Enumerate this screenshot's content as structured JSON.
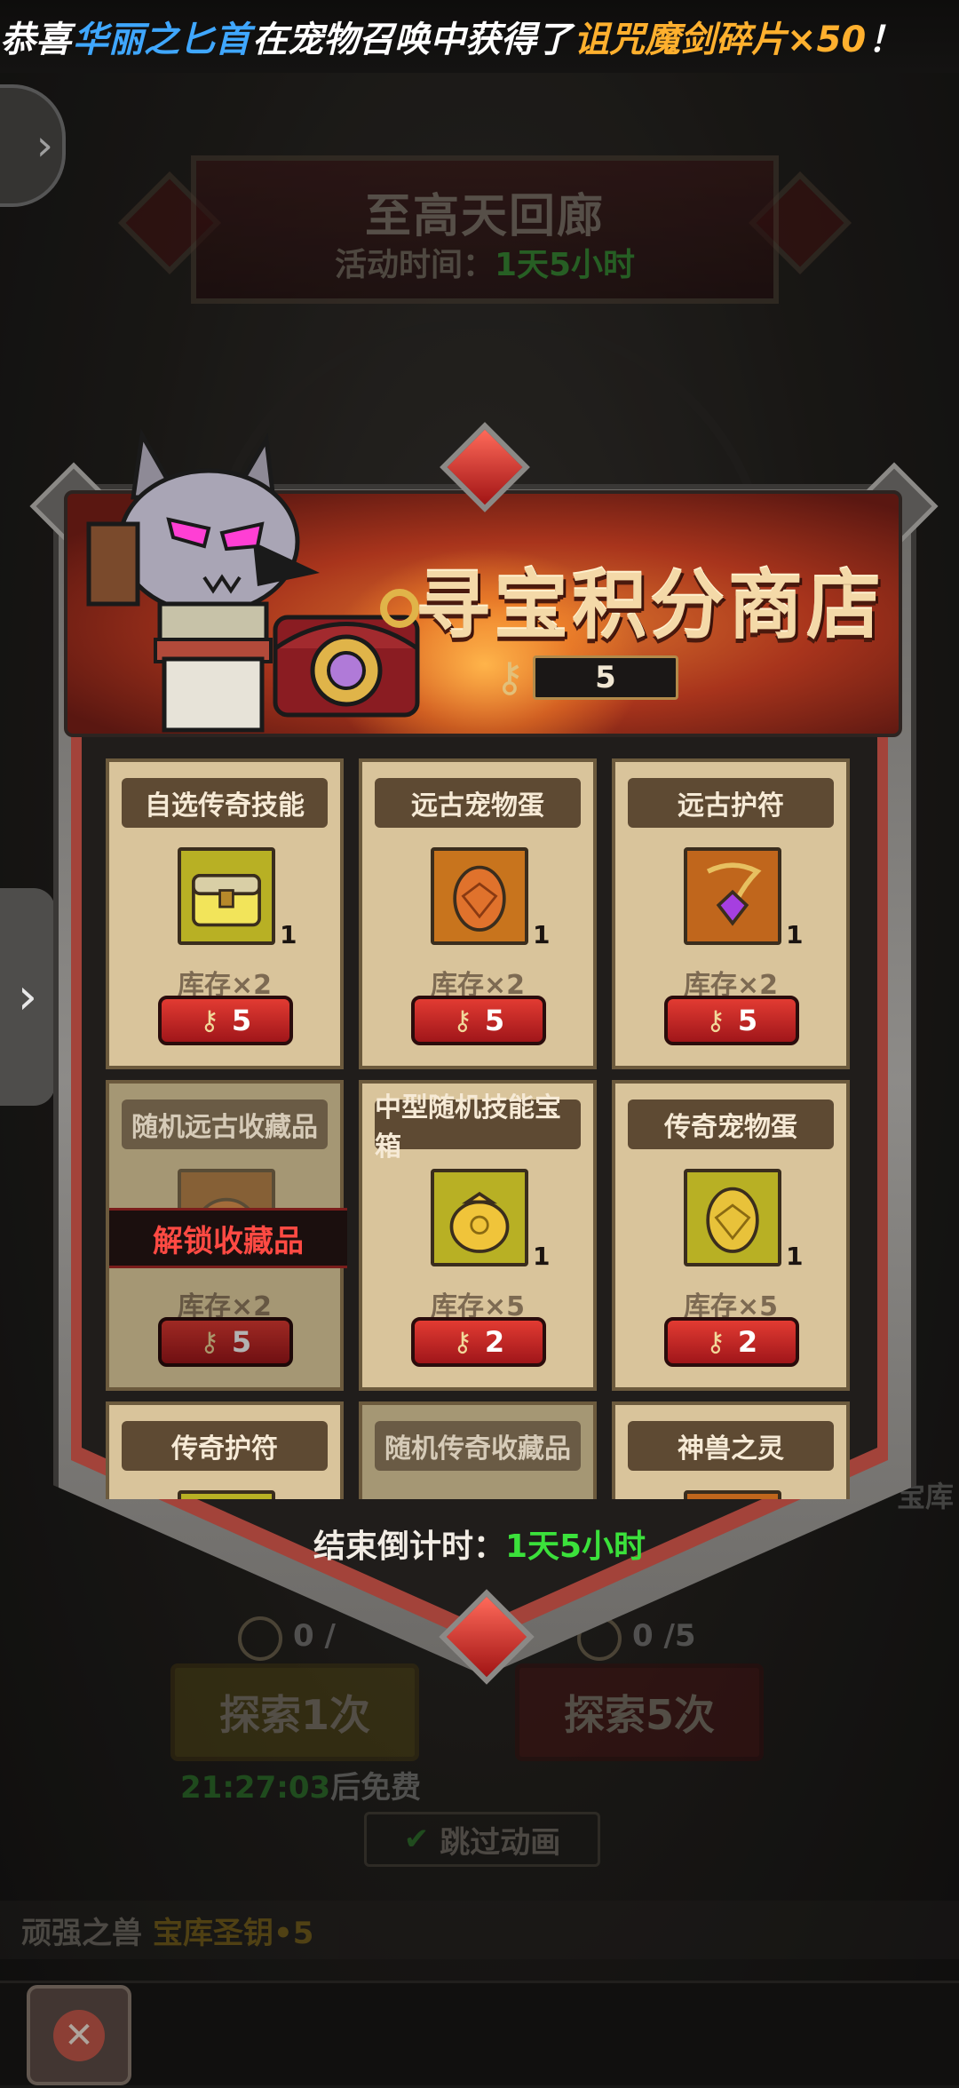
{
  "ticker": {
    "prefix": "恭喜",
    "player": "华丽之匕首",
    "middle": "在宠物召唤中获得了",
    "item": "诅咒魔剑碎片×50",
    "suffix": "！"
  },
  "event": {
    "title": "至高天回廊",
    "time_label": "活动时间：",
    "time_value": "1天5小时"
  },
  "shop": {
    "title": "寻宝积分商店",
    "key_count": "5",
    "items": [
      {
        "name": "自选传奇技能",
        "qty": "1",
        "stock": "库存×2",
        "price": "5",
        "locked": false,
        "icon": "chest-icon"
      },
      {
        "name": "远古宠物蛋",
        "qty": "1",
        "stock": "库存×2",
        "price": "5",
        "locked": false,
        "icon": "egg-icon"
      },
      {
        "name": "远古护符",
        "qty": "1",
        "stock": "库存×2",
        "price": "5",
        "locked": false,
        "icon": "amulet-icon"
      },
      {
        "name": "随机远古收藏品",
        "qty": "",
        "stock": "库存×2",
        "price": "5",
        "locked": true,
        "lock_text": "解锁收藏品",
        "icon": "bag-icon"
      },
      {
        "name": "中型随机技能宝箱",
        "qty": "1",
        "stock": "库存×5",
        "price": "2",
        "locked": false,
        "icon": "bag-icon"
      },
      {
        "name": "传奇宠物蛋",
        "qty": "1",
        "stock": "库存×5",
        "price": "2",
        "locked": false,
        "icon": "egg-icon"
      },
      {
        "name": "传奇护符",
        "qty": "",
        "stock": "",
        "price": "",
        "locked": false,
        "icon": "amulet-icon"
      },
      {
        "name": "随机传奇收藏品",
        "qty": "",
        "stock": "",
        "price": "",
        "locked": true,
        "icon": "bag-icon"
      },
      {
        "name": "神兽之灵",
        "qty": "",
        "stock": "",
        "price": "",
        "locked": false,
        "icon": "spirit-icon"
      }
    ],
    "countdown_label": "结束倒计时：",
    "countdown_value": "1天5小时"
  },
  "background": {
    "count_left": "0 /",
    "count_right": "0 /5",
    "explore1": "探索1次",
    "explore5": "探索5次",
    "free_time": "21:27:03",
    "free_suffix": "后免费",
    "skip": "跳过动画",
    "reward_name": "顽强之兽",
    "reward_item": "宝库圣钥•5",
    "vault": "宝库"
  },
  "colors": {
    "accent_green": "#3be13b",
    "accent_blue": "#3fa7ff",
    "accent_orange": "#ffb02e",
    "price_red": "#c8262a",
    "card_bg": "#d9c49b"
  }
}
